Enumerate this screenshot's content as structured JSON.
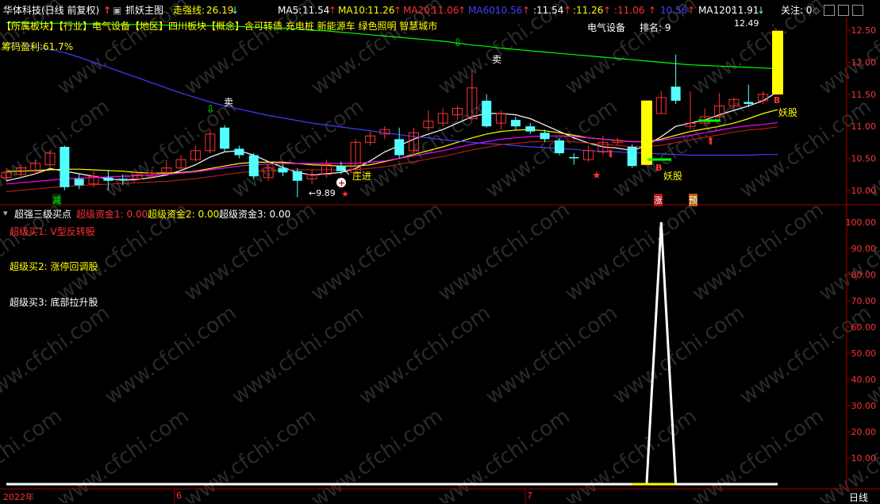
{
  "header": {
    "stock_title": "华体科技(日线 前复权)",
    "main_indicator": "抓妖主图",
    "strong_line_label": "走强线:",
    "strong_line_value": "26.19",
    "ma5_label": "MA5:",
    "ma5_value": "11.54",
    "ma10_label": "MA10:",
    "ma10_value": "11.26",
    "ma20_label": "MA20:",
    "ma20_value": "11.06",
    "ma60_label": "MA60:",
    "ma60_value": "10.56",
    "repeat_1": ":11.54",
    "repeat_2": ":11.26",
    "repeat_3": ":11.06",
    "repeat_4": "10.56",
    "ma120_label": "MA120:",
    "ma120_value": "11.91",
    "watch_label": "关注: 0"
  },
  "sector_line": "【所属板块】【行业】电气设备【地区】四川板块【概念】含可转债 充电桩 新能源车 绿色照明 智慧城市",
  "chip_profit": "筹码盈利:61.7%",
  "industry": "电气设备",
  "rank": "排名: 9",
  "annotations": {
    "sell_1": "卖",
    "sell_2": "卖",
    "low_price": "←9.89",
    "zhuang_jin": "庄进",
    "yao_gu_1": "妖股",
    "yao_gu_2": "妖股",
    "high_price": "12.49",
    "jian": "减",
    "zhang": "涨",
    "yu": "预",
    "b_1": "B",
    "b_2": "B"
  },
  "sub_panel": {
    "title": "超强三级买点",
    "fund1": "超级资金1: 0.00",
    "fund2": "超级资金2: 0.00",
    "fund3": "超级资金3: 0.00",
    "buy1": "超级买1: V型反转股",
    "buy2": "超级买2: 涨停回调股",
    "buy3": "超级买3: 底部拉升股"
  },
  "footer": {
    "year_label": "2022年",
    "month_6": "6",
    "month_7": "7",
    "period": "日线"
  },
  "watermark": "www.cfchi.com",
  "colors": {
    "up": "#ff3232",
    "down": "#54ffff",
    "ma5": "#ffffff",
    "ma10": "#ffff00",
    "ma20": "#ff00ff",
    "ma60": "#00ff00",
    "ma120": "#4040ff",
    "yellow": "#ffff00",
    "grid_red": "#8b0000"
  },
  "chart_data": [
    {
      "type": "candlestick",
      "title": "抓妖主图",
      "ylim": [
        9.8,
        12.7
      ],
      "yticks": [
        10.0,
        10.5,
        11.0,
        11.5,
        12.0,
        12.5
      ],
      "x_labels": [
        "2022年",
        "6",
        "7"
      ],
      "candles": [
        {
          "o": 10.2,
          "c": 10.28,
          "h": 10.35,
          "l": 10.15
        },
        {
          "o": 10.25,
          "c": 10.35,
          "h": 10.4,
          "l": 10.18
        },
        {
          "o": 10.3,
          "c": 10.42,
          "h": 10.48,
          "l": 10.25
        },
        {
          "o": 10.4,
          "c": 10.58,
          "h": 10.62,
          "l": 10.35
        },
        {
          "o": 10.68,
          "c": 10.05,
          "h": 10.7,
          "l": 10.0
        },
        {
          "o": 10.18,
          "c": 10.08,
          "h": 10.25,
          "l": 10.02
        },
        {
          "o": 10.1,
          "c": 10.22,
          "h": 10.3,
          "l": 10.05
        },
        {
          "o": 10.2,
          "c": 10.15,
          "h": 10.32,
          "l": 10.0
        },
        {
          "o": 10.18,
          "c": 10.16,
          "h": 10.25,
          "l": 10.08
        },
        {
          "o": 10.18,
          "c": 10.24,
          "h": 10.3,
          "l": 10.15
        },
        {
          "o": 10.22,
          "c": 10.27,
          "h": 10.33,
          "l": 10.18
        },
        {
          "o": 10.28,
          "c": 10.35,
          "h": 10.48,
          "l": 10.25
        },
        {
          "o": 10.35,
          "c": 10.48,
          "h": 10.55,
          "l": 10.32
        },
        {
          "o": 10.48,
          "c": 10.62,
          "h": 10.7,
          "l": 10.45
        },
        {
          "o": 10.62,
          "c": 10.88,
          "h": 10.95,
          "l": 10.58
        },
        {
          "o": 10.98,
          "c": 10.65,
          "h": 11.02,
          "l": 10.6
        },
        {
          "o": 10.65,
          "c": 10.55,
          "h": 10.7,
          "l": 10.5
        },
        {
          "o": 10.55,
          "c": 10.22,
          "h": 10.58,
          "l": 10.18
        },
        {
          "o": 10.2,
          "c": 10.35,
          "h": 10.4,
          "l": 10.15
        },
        {
          "o": 10.35,
          "c": 10.28,
          "h": 10.42,
          "l": 10.22
        },
        {
          "o": 10.3,
          "c": 10.15,
          "h": 10.35,
          "l": 9.89
        },
        {
          "o": 10.18,
          "c": 10.25,
          "h": 10.32,
          "l": 10.1
        },
        {
          "o": 10.25,
          "c": 10.4,
          "h": 10.48,
          "l": 10.2
        },
        {
          "o": 10.38,
          "c": 10.3,
          "h": 10.45,
          "l": 10.25
        },
        {
          "o": 10.28,
          "c": 10.75,
          "h": 10.8,
          "l": 10.25
        },
        {
          "o": 10.75,
          "c": 10.85,
          "h": 10.92,
          "l": 10.7
        },
        {
          "o": 10.88,
          "c": 10.95,
          "h": 11.0,
          "l": 10.8
        },
        {
          "o": 10.8,
          "c": 10.55,
          "h": 10.98,
          "l": 10.5
        },
        {
          "o": 10.62,
          "c": 10.9,
          "h": 10.98,
          "l": 10.55
        },
        {
          "o": 10.98,
          "c": 11.08,
          "h": 11.25,
          "l": 10.92
        },
        {
          "o": 11.05,
          "c": 11.2,
          "h": 11.28,
          "l": 11.0
        },
        {
          "o": 11.18,
          "c": 11.28,
          "h": 11.32,
          "l": 11.1
        },
        {
          "o": 11.12,
          "c": 11.6,
          "h": 11.88,
          "l": 11.1
        },
        {
          "o": 11.4,
          "c": 11.0,
          "h": 11.5,
          "l": 10.98
        },
        {
          "o": 11.05,
          "c": 11.2,
          "h": 11.25,
          "l": 10.95
        },
        {
          "o": 11.1,
          "c": 11.0,
          "h": 11.15,
          "l": 10.95
        },
        {
          "o": 11.0,
          "c": 10.92,
          "h": 11.05,
          "l": 10.88
        },
        {
          "o": 10.9,
          "c": 10.8,
          "h": 10.95,
          "l": 10.75
        },
        {
          "o": 10.78,
          "c": 10.58,
          "h": 10.82,
          "l": 10.55
        },
        {
          "o": 10.52,
          "c": 10.5,
          "h": 10.58,
          "l": 10.4
        },
        {
          "o": 10.48,
          "c": 10.62,
          "h": 10.7,
          "l": 10.45
        },
        {
          "o": 10.6,
          "c": 10.75,
          "h": 10.85,
          "l": 10.55
        },
        {
          "o": 10.75,
          "c": 10.78,
          "h": 10.82,
          "l": 10.7
        },
        {
          "o": 10.68,
          "c": 10.38,
          "h": 10.72,
          "l": 10.35
        },
        {
          "o": 10.4,
          "c": 11.4,
          "h": 11.4,
          "l": 10.4
        },
        {
          "o": 11.2,
          "c": 11.45,
          "h": 11.55,
          "l": 11.2
        },
        {
          "o": 11.62,
          "c": 11.4,
          "h": 12.12,
          "l": 11.35
        },
        {
          "o": 11.0,
          "c": 11.05,
          "h": 11.55,
          "l": 10.95
        },
        {
          "o": 11.05,
          "c": 11.15,
          "h": 11.28,
          "l": 11.0
        },
        {
          "o": 11.15,
          "c": 11.32,
          "h": 11.52,
          "l": 11.1
        },
        {
          "o": 11.32,
          "c": 11.42,
          "h": 11.45,
          "l": 11.25
        },
        {
          "o": 11.38,
          "c": 11.35,
          "h": 11.65,
          "l": 11.3
        },
        {
          "o": 11.4,
          "c": 11.5,
          "h": 11.55,
          "l": 11.35
        },
        {
          "o": 11.5,
          "c": 12.49,
          "h": 12.49,
          "l": 11.5
        }
      ],
      "series": [
        {
          "name": "MA5",
          "values": [
            10.15,
            10.2,
            10.26,
            10.34,
            10.3,
            10.26,
            10.22,
            10.18,
            10.16,
            10.17,
            10.2,
            10.24,
            10.31,
            10.4,
            10.52,
            10.6,
            10.62,
            10.55,
            10.45,
            10.36,
            10.28,
            10.24,
            10.26,
            10.28,
            10.34,
            10.46,
            10.6,
            10.7,
            10.8,
            10.88,
            10.95,
            11.05,
            11.15,
            11.2,
            11.2,
            11.18,
            11.12,
            11.02,
            10.92,
            10.82,
            10.74,
            10.68,
            10.66,
            10.62,
            10.7,
            10.84,
            11.0,
            11.05,
            11.1,
            11.18,
            11.25,
            11.32,
            11.4,
            11.54
          ]
        },
        {
          "name": "MA10",
          "values": [
            10.3,
            10.3,
            10.31,
            10.32,
            10.33,
            10.33,
            10.32,
            10.31,
            10.3,
            10.28,
            10.27,
            10.27,
            10.28,
            10.3,
            10.34,
            10.38,
            10.42,
            10.44,
            10.44,
            10.44,
            10.42,
            10.4,
            10.39,
            10.38,
            10.38,
            10.4,
            10.45,
            10.5,
            10.56,
            10.62,
            10.68,
            10.75,
            10.82,
            10.88,
            10.92,
            10.94,
            10.95,
            10.93,
            10.9,
            10.86,
            10.82,
            10.8,
            10.78,
            10.76,
            10.76,
            10.8,
            10.86,
            10.92,
            10.96,
            11.0,
            11.05,
            11.12,
            11.2,
            11.26
          ]
        },
        {
          "name": "MA20",
          "values": [
            10.1,
            10.12,
            10.14,
            10.16,
            10.18,
            10.19,
            10.2,
            10.21,
            10.22,
            10.23,
            10.24,
            10.25,
            10.27,
            10.29,
            10.32,
            10.35,
            10.38,
            10.4,
            10.41,
            10.42,
            10.42,
            10.42,
            10.42,
            10.42,
            10.42,
            10.44,
            10.46,
            10.5,
            10.54,
            10.58,
            10.62,
            10.67,
            10.72,
            10.76,
            10.8,
            10.82,
            10.84,
            10.85,
            10.85,
            10.84,
            10.82,
            10.8,
            10.78,
            10.76,
            10.76,
            10.78,
            10.82,
            10.86,
            10.9,
            10.94,
            10.98,
            11.01,
            11.03,
            11.06
          ]
        },
        {
          "name": "MA60",
          "values": [
            12.62,
            12.62,
            12.61,
            12.61,
            12.61,
            12.6,
            12.6,
            12.6,
            12.59,
            12.59,
            12.59,
            12.58,
            12.58,
            12.58,
            12.57,
            12.57,
            12.56,
            12.55,
            12.54,
            12.53,
            12.52,
            12.5,
            12.49,
            12.47,
            12.45,
            12.43,
            12.41,
            12.39,
            12.37,
            12.35,
            12.33,
            12.3,
            12.27,
            12.25,
            12.22,
            12.2,
            12.18,
            12.16,
            12.14,
            12.12,
            12.1,
            12.08,
            12.06,
            12.04,
            12.02,
            12.0,
            11.98,
            11.96,
            11.95,
            11.94,
            11.93,
            11.92,
            11.91,
            11.9
          ]
        },
        {
          "name": "MA120",
          "values": [
            12.3,
            12.27,
            12.24,
            12.2,
            12.15,
            12.08,
            12.0,
            11.92,
            11.84,
            11.76,
            11.68,
            11.6,
            11.52,
            11.45,
            11.38,
            11.32,
            11.27,
            11.22,
            11.17,
            11.13,
            11.09,
            11.05,
            11.02,
            10.99,
            10.96,
            10.93,
            10.9,
            10.87,
            10.84,
            10.82,
            10.79,
            10.77,
            10.75,
            10.73,
            10.72,
            10.7,
            10.68,
            10.67,
            10.65,
            10.64,
            10.62,
            10.61,
            10.6,
            10.59,
            10.58,
            10.57,
            10.56,
            10.55,
            10.55,
            10.55,
            10.55,
            10.55,
            10.56,
            10.56
          ]
        }
      ]
    },
    {
      "type": "line",
      "title": "超强三级买点",
      "ylim": [
        0,
        100
      ],
      "yticks": [
        10.0,
        20.0,
        30.0,
        40.0,
        50.0,
        60.0,
        70.0,
        80.0,
        90.0,
        100.0
      ],
      "series": [
        {
          "name": "超级资金1",
          "values": [
            0,
            0,
            0,
            0,
            0,
            0,
            0,
            0,
            0,
            0,
            0,
            0,
            0,
            0,
            0,
            0,
            0,
            0,
            0,
            0,
            0,
            0,
            0,
            0,
            0,
            0,
            0,
            0,
            0,
            0,
            0,
            0,
            0,
            0,
            0,
            0,
            0,
            0,
            0,
            0,
            0,
            0,
            0,
            0,
            0,
            100,
            0,
            0,
            0,
            0,
            0,
            0,
            0,
            0
          ]
        },
        {
          "name": "超级资金2",
          "values": [
            0,
            0,
            0,
            0,
            0,
            0,
            0,
            0,
            0,
            0,
            0,
            0,
            0,
            0,
            0,
            0,
            0,
            0,
            0,
            0,
            0,
            0,
            0,
            0,
            0,
            0,
            0,
            0,
            0,
            0,
            0,
            0,
            0,
            0,
            0,
            0,
            0,
            0,
            0,
            0,
            0,
            0,
            0,
            0,
            0,
            0,
            0,
            0,
            0,
            0,
            0,
            0,
            0,
            0
          ]
        },
        {
          "name": "超级资金3",
          "values": [
            0,
            0,
            0,
            0,
            0,
            0,
            0,
            0,
            0,
            0,
            0,
            0,
            0,
            0,
            0,
            0,
            0,
            0,
            0,
            0,
            0,
            0,
            0,
            0,
            0,
            0,
            0,
            0,
            0,
            0,
            0,
            0,
            0,
            0,
            0,
            0,
            0,
            0,
            0,
            0,
            0,
            0,
            0,
            0,
            0,
            0,
            0,
            0,
            0,
            0,
            0,
            0,
            0,
            0
          ]
        }
      ]
    }
  ]
}
